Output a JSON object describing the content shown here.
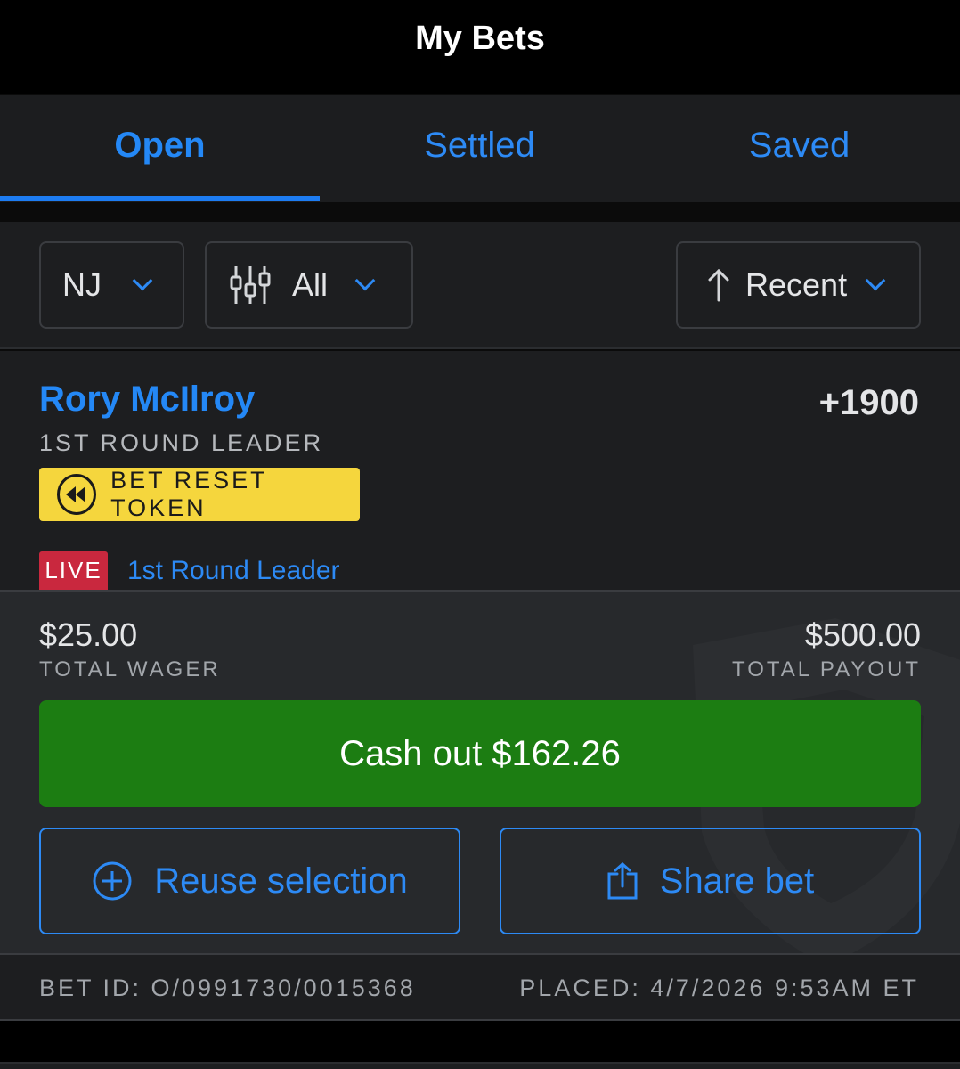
{
  "header": {
    "title": "My Bets"
  },
  "tabs": [
    {
      "label": "Open",
      "active": true
    },
    {
      "label": "Settled",
      "active": false
    },
    {
      "label": "Saved",
      "active": false
    }
  ],
  "filters": {
    "state": {
      "label": "NJ",
      "icon": "chevron-down-icon"
    },
    "type": {
      "label": "All",
      "icon": "sliders-icon"
    },
    "sort": {
      "label": "Recent",
      "icon": "arrow-up-icon"
    }
  },
  "bet": {
    "player": "Rory McIlroy",
    "odds": "+1900",
    "market": "1ST ROUND LEADER",
    "token_label": "BET RESET TOKEN",
    "live_badge": "LIVE",
    "live_event": "1st Round Leader",
    "wager": "$25.00",
    "wager_label": "TOTAL WAGER",
    "payout": "$500.00",
    "payout_label": "TOTAL PAYOUT",
    "cashout_label": "Cash out $162.26",
    "reuse_label": "Reuse selection",
    "share_label": "Share bet",
    "bet_id": "BET ID: O/0991730/0015368",
    "placed": "PLACED: 4/7/2026 9:53AM ET"
  },
  "colors": {
    "accent": "#2488f6",
    "cashout": "#1c7d12",
    "token": "#f5d63d",
    "live": "#c9283e"
  }
}
